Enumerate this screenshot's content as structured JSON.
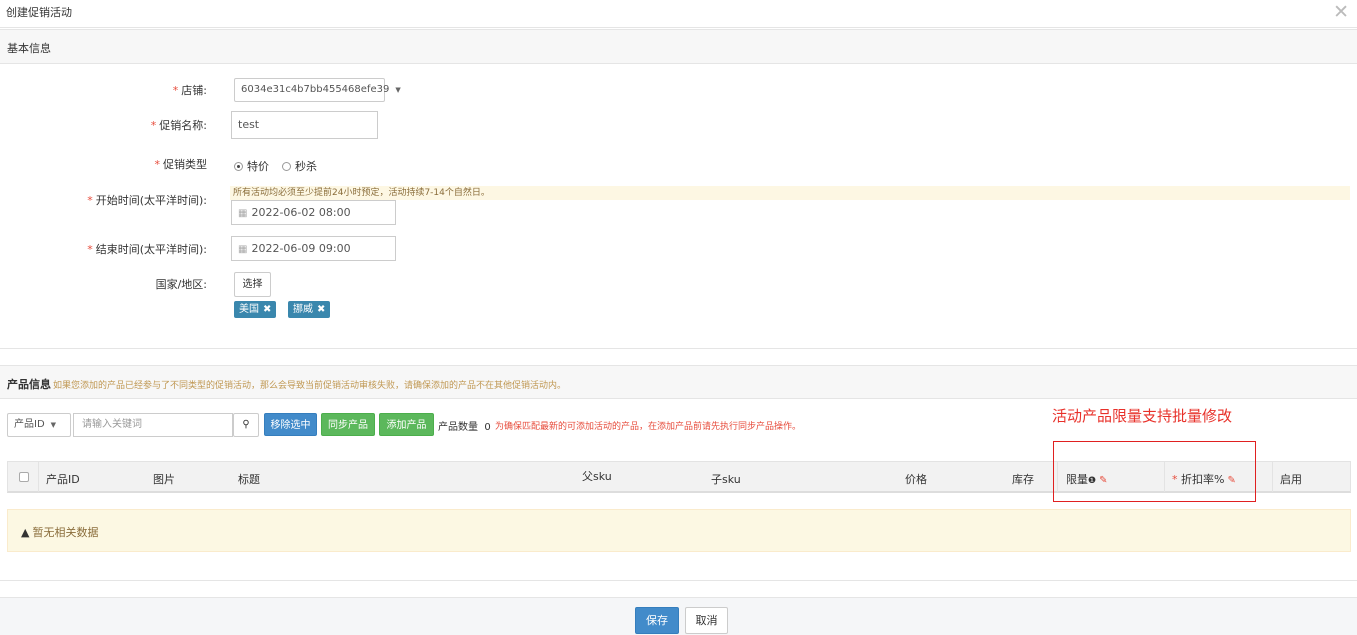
{
  "dialog": {
    "title": "创建促销活动",
    "close_glyph": "✕"
  },
  "basic": {
    "section_title": "基本信息",
    "required_mark": "*",
    "store": {
      "label": "店铺:",
      "value": "6034e31c4b7bb455468efe39",
      "caret": "▼"
    },
    "promo_name": {
      "label": "促销名称:",
      "value": "test"
    },
    "promo_type": {
      "label": "促销类型",
      "options": [
        "特价",
        "秒杀"
      ],
      "selected": "特价"
    },
    "start_time": {
      "label": "开始时间(太平洋时间):",
      "notice": "所有活动均必须至少提前24小时预定，活动持续7-14个自然日。",
      "value": "2022-06-02 08:00"
    },
    "end_time": {
      "label": "结束时间(太平洋时间):",
      "value": "2022-06-09 09:00"
    },
    "region": {
      "label": "国家/地区:",
      "choose_button": "选择",
      "tags": [
        "美国",
        "挪威"
      ],
      "tag_remove_glyph": "✖"
    }
  },
  "products": {
    "section_title": "产品信息",
    "section_notice": "如果您添加的产品已经参与了不同类型的促销活动，那么会导致当前促销活动审核失败，请确保添加的产品不在其他促销活动内。",
    "annotation": "活动产品限量支持批量修改",
    "toolbar": {
      "field_select": "产品ID",
      "field_caret": "▼",
      "search_placeholder": "请输入关键词",
      "search_glyph": "🔍",
      "remove_selected": "移除选中",
      "sync_products": "同步产品",
      "add_products": "添加产品",
      "count_label": "产品数量",
      "count_value": "0",
      "tip": "为确保匹配最新的可添加活动的产品，在添加产品前请先执行同步产品操作。"
    },
    "table": {
      "headers": {
        "product_id": "产品ID",
        "image": "图片",
        "title": "标题",
        "parent_sku": "父sku",
        "child_sku": "子sku",
        "price": "价格",
        "stock": "库存",
        "limit": "限量",
        "limit_info_glyph": "❶",
        "discount": "折扣率%",
        "enabled": "启用",
        "batch_edit_glyph": "✎"
      },
      "empty_icon": "▲",
      "empty_text": "暂无相关数据"
    }
  },
  "footer": {
    "save": "保存",
    "cancel": "取消"
  },
  "colors": {
    "primary": "#428bca",
    "success": "#5cb85c",
    "danger": "#e74c3c",
    "warning_bg": "#fcf8e3",
    "tag_bg": "#3a87ad"
  }
}
